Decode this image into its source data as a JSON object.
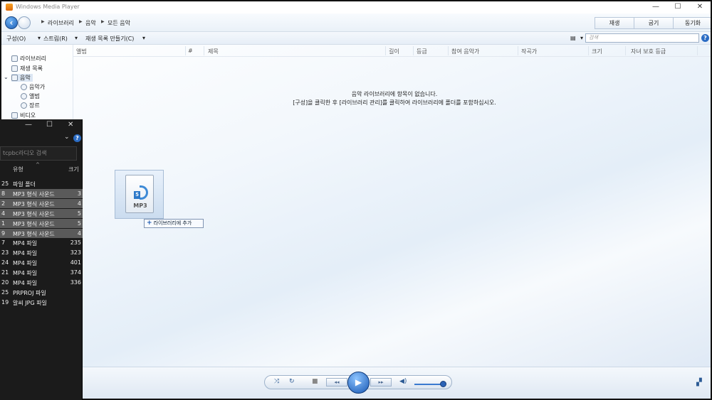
{
  "window": {
    "title": "Windows Media Player",
    "minimize": "—",
    "maximize": "☐",
    "close": "✕"
  },
  "breadcrumbs": [
    "라이브러리",
    "음악",
    "모든 음악"
  ],
  "tabs": [
    "재생",
    "굽기",
    "동기화"
  ],
  "toolbar": {
    "organize": "구성(O)",
    "stream": "스트림(R)",
    "create_playlist": "재생 목록 만들기(C)",
    "search_placeholder": "검색"
  },
  "nav": {
    "items": [
      {
        "label": "라이브러리",
        "icon": "library-icon"
      },
      {
        "label": "재생 목록",
        "icon": "playlist-icon"
      },
      {
        "label": "음악",
        "icon": "music-note-icon",
        "selected": true
      },
      {
        "label": "음악가",
        "icon": "artist-icon"
      },
      {
        "label": "앨범",
        "icon": "album-icon"
      },
      {
        "label": "장르",
        "icon": "genre-icon"
      },
      {
        "label": "비디오",
        "icon": "video-icon"
      }
    ]
  },
  "columns": [
    "앨범",
    "#",
    "제목",
    "길이",
    "등급",
    "참여 음악가",
    "작곡가",
    "크기",
    "자녀 보호 등급"
  ],
  "empty_message": {
    "line1": "음악 라이브러리에 항목이 없습니다.",
    "line2": "[구성]을 클릭한 후 [라이브러리 관리]를 클릭하여 라이브러리에 폴더를 포함하십시오."
  },
  "drag": {
    "file_label": "MP3",
    "tooltip": "라이브러리에 추가"
  },
  "explorer": {
    "minimize": "—",
    "maximize": "☐",
    "close": "✕",
    "search_placeholder": "tcpbc라디오 검색",
    "col_type": "유형",
    "col_size": "크기",
    "rows": [
      {
        "prefix": "25",
        "type": "파일 폴더",
        "size": "",
        "selected": false
      },
      {
        "prefix": "8",
        "type": "MP3 형식 사운드",
        "size": "3",
        "selected": true
      },
      {
        "prefix": "2",
        "type": "MP3 형식 사운드",
        "size": "4",
        "selected": true
      },
      {
        "prefix": "4",
        "type": "MP3 형식 사운드",
        "size": "5",
        "selected": true
      },
      {
        "prefix": "1",
        "type": "MP3 형식 사운드",
        "size": "5",
        "selected": true
      },
      {
        "prefix": "9",
        "type": "MP3 형식 사운드",
        "size": "4",
        "selected": true
      },
      {
        "prefix": "7",
        "type": "MP4 파일",
        "size": "235",
        "selected": false
      },
      {
        "prefix": "23",
        "type": "MP4 파일",
        "size": "323",
        "selected": false
      },
      {
        "prefix": "24",
        "type": "MP4 파일",
        "size": "401",
        "selected": false
      },
      {
        "prefix": "21",
        "type": "MP4 파일",
        "size": "374",
        "selected": false
      },
      {
        "prefix": "20",
        "type": "MP4 파일",
        "size": "336",
        "selected": false
      },
      {
        "prefix": "25",
        "type": "PRPROJ 파일",
        "size": "",
        "selected": false
      },
      {
        "prefix": "19",
        "type": "알씨 JPG 파일",
        "size": "",
        "selected": false
      }
    ]
  },
  "colors": {
    "accent": "#1857b3",
    "selection": "#5a5a5a",
    "explorer_bg": "#1b1b1b"
  }
}
